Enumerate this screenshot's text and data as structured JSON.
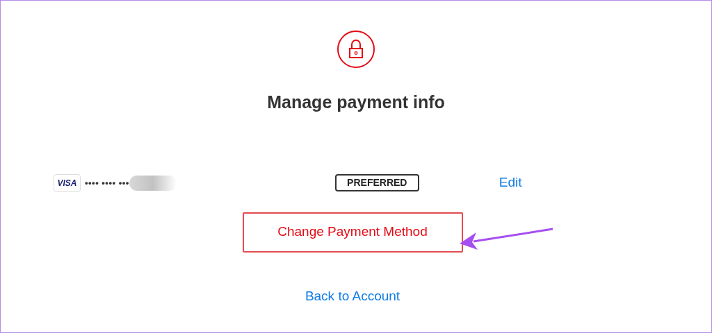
{
  "title": "Manage payment info",
  "card": {
    "brand": "VISA",
    "masked_number": "•••• •••• •••",
    "badge": "PREFERRED",
    "edit_link": "Edit"
  },
  "change_button": "Change Payment Method",
  "back_link": "Back to Account"
}
